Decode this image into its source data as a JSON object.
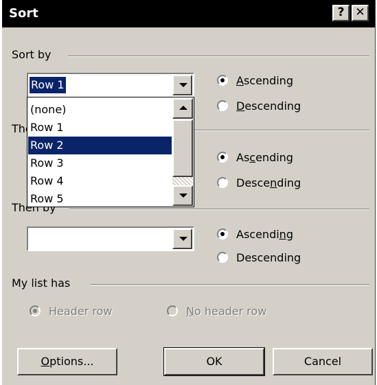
{
  "window": {
    "title": "Sort",
    "help_glyph": "?",
    "close_glyph": "✕"
  },
  "sort_by": {
    "label": "Sort by",
    "combo_value": "Row 1",
    "ascending": {
      "pre": "",
      "key": "A",
      "post": "scending",
      "checked": true
    },
    "descending": {
      "pre": "",
      "key": "D",
      "post": "escending",
      "checked": false
    }
  },
  "dropdown": {
    "items": [
      "(none)",
      "Row 1",
      "Row 2",
      "Row 3",
      "Row 4",
      "Row 5"
    ],
    "selected_index": 2
  },
  "then_by_1": {
    "label": "Then by",
    "ascending": {
      "pre": "As",
      "key": "c",
      "post": "ending",
      "checked": true
    },
    "descending": {
      "pre": "Desce",
      "key": "n",
      "post": "ding",
      "checked": false
    }
  },
  "then_by_2": {
    "label": "Then by",
    "combo_value": "",
    "ascending": {
      "pre": "Ascendi",
      "key": "n",
      "post": "g",
      "checked": true
    },
    "descending": {
      "pre": "Descendin",
      "key": "g",
      "post": "",
      "checked": false
    }
  },
  "my_list_has": {
    "label": "My list has",
    "header_row": {
      "pre": "",
      "key": "",
      "post": "Header row",
      "checked": true
    },
    "no_header_row": {
      "pre": "",
      "key": "N",
      "post": "o header row",
      "checked": false
    }
  },
  "buttons": {
    "options": {
      "pre": "",
      "key": "O",
      "post": "ptions..."
    },
    "ok": "OK",
    "cancel": "Cancel"
  },
  "colors": {
    "face": "#d4d0c8",
    "selection": "#0a246a",
    "titlebar": "#000000"
  }
}
